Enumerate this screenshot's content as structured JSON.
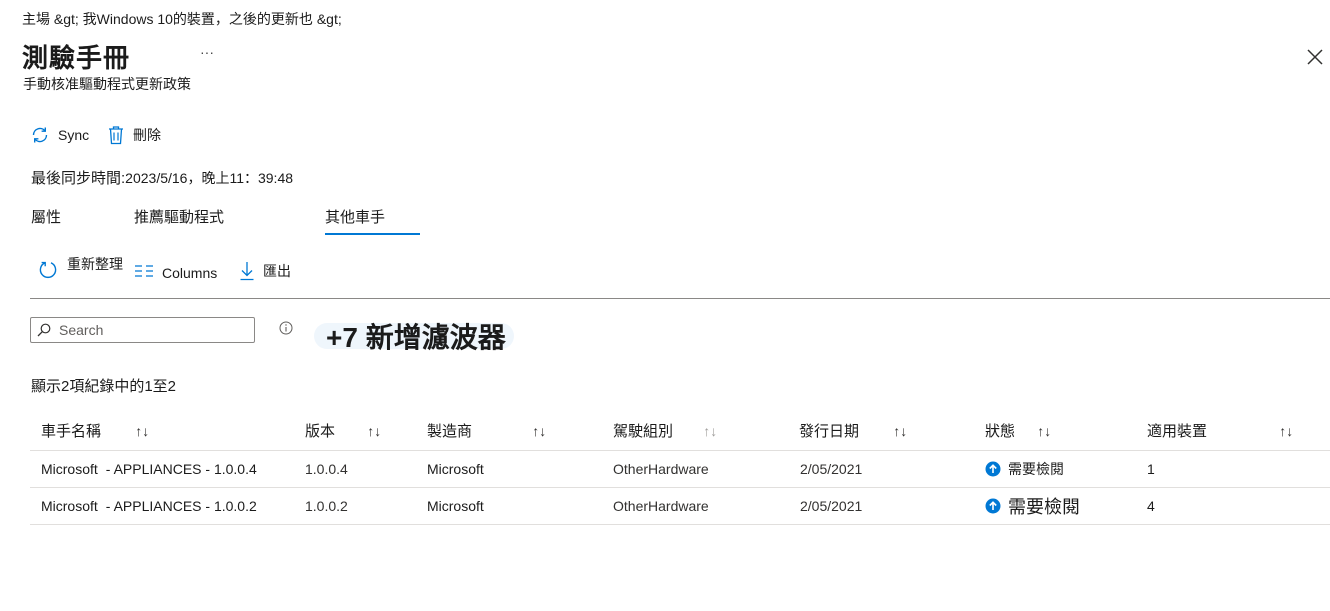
{
  "breadcrumb": "主場 &gt;  我Windows  10的裝置，之後的更新也 &gt;",
  "header": {
    "title": "測驗手冊",
    "more": "···",
    "subtitle": "手動核准驅動程式更新政策"
  },
  "commands": {
    "sync": "Sync",
    "delete": "刪除"
  },
  "last_sync": {
    "label": "最後同步時間:",
    "value": "2023/5/16，晚上11：39:48"
  },
  "tabs": [
    "屬性",
    "推薦驅動程式",
    "其他車手"
  ],
  "toolbar": {
    "refresh": "重新整理",
    "columns": "Columns",
    "export": "匯出"
  },
  "search": {
    "placeholder": "Search"
  },
  "filter": {
    "label": "+7 新增濾波器"
  },
  "record_count": "顯示2項紀錄中的1至2",
  "table": {
    "headers": [
      "車手名稱",
      "版本",
      "製造商",
      "駕駛組別",
      "發行日期",
      "狀態",
      "適用裝置"
    ],
    "sort_glyph": "↑↓",
    "rows": [
      {
        "name_vendor": "Microsoft",
        "name_rest": "- APPLIANCES - 1.0.0.4",
        "version": "1.0.0.4",
        "manufacturer": "Microsoft",
        "group": "OtherHardware",
        "date": "2/05/2021",
        "status": "需要檢閱",
        "devices": "1"
      },
      {
        "name_vendor": "Microsoft",
        "name_rest": "- APPLIANCES - 1.0.0.2",
        "version": "1.0.0.2",
        "manufacturer": "Microsoft",
        "group": "OtherHardware",
        "date": "2/05/2021",
        "status": "需要檢閱",
        "devices": "4"
      }
    ]
  },
  "colors": {
    "accent": "#0078d4",
    "border": "#e1dfdd"
  }
}
